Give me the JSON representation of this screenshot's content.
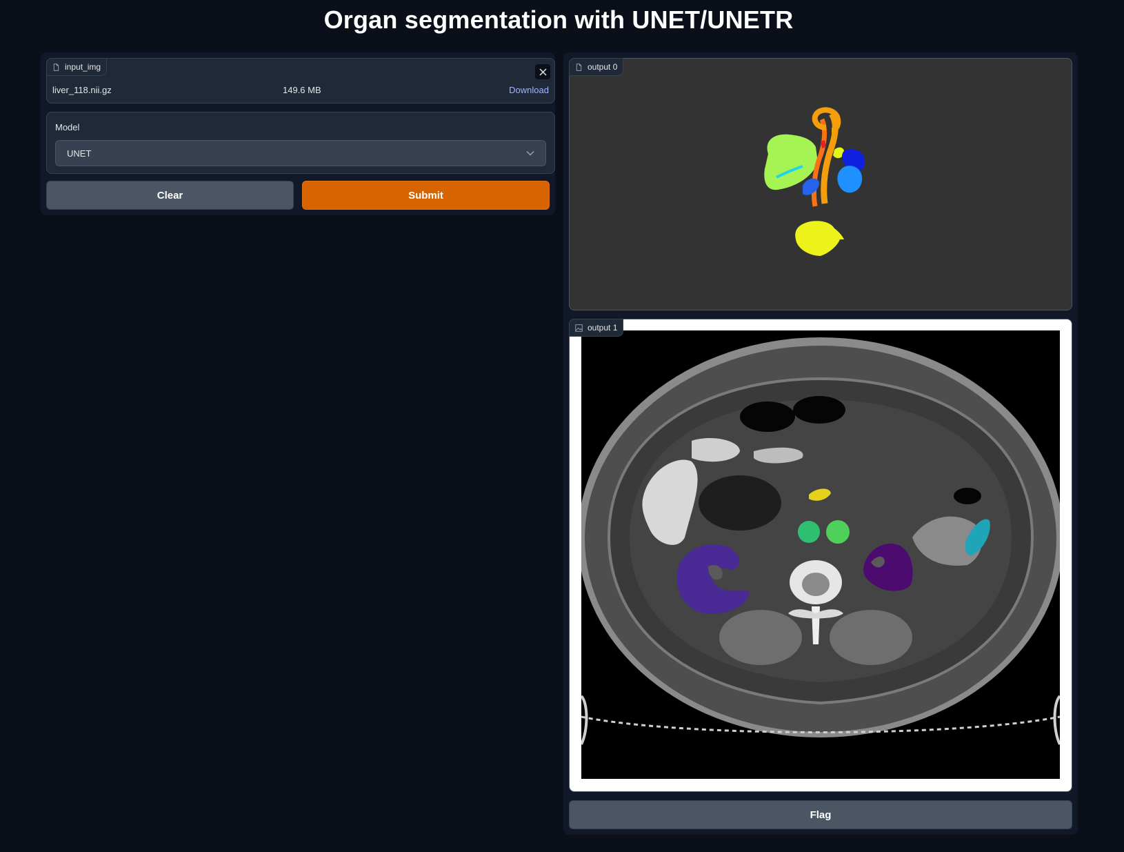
{
  "header": {
    "title": "Organ segmentation with UNET/UNETR"
  },
  "input_file": {
    "label": "input_img",
    "file_name": "liver_118.nii.gz",
    "file_size": "149.6 MB",
    "download_label": "Download"
  },
  "model": {
    "label": "Model",
    "selected": "UNET"
  },
  "actions": {
    "clear_label": "Clear",
    "submit_label": "Submit",
    "flag_label": "Flag"
  },
  "outputs": [
    {
      "label": "output 0",
      "kind": "file"
    },
    {
      "label": "output 1",
      "kind": "image"
    }
  ],
  "colors": {
    "background": "#0b0f19",
    "panel": "#111827",
    "accent": "#d66400",
    "link": "#a5b4fc"
  },
  "icons": {
    "file": "file-icon",
    "image": "image-icon",
    "close": "close-icon",
    "dropdown": "chevron-down-icon"
  }
}
